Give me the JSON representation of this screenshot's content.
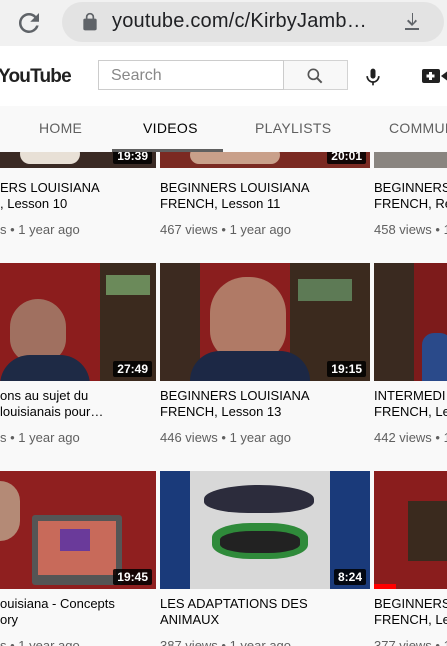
{
  "browser": {
    "url": "youtube.com/c/KirbyJamb…"
  },
  "header": {
    "logo": "YouTube",
    "search_placeholder": "Search"
  },
  "tabs": [
    {
      "label": "HOME",
      "active": false
    },
    {
      "label": "VIDEOS",
      "active": true
    },
    {
      "label": "PLAYLISTS",
      "active": false
    },
    {
      "label": "COMMUN",
      "active": false
    }
  ],
  "videos": [
    {
      "duration": "19:39",
      "title1": "ERS LOUISIANA",
      "title2": ", Lesson 10",
      "meta": "s • 1 year ago"
    },
    {
      "duration": "20:01",
      "title1": "BEGINNERS LOUISIANA",
      "title2": "FRENCH, Lesson 11",
      "meta": "467 views • 1 year ago"
    },
    {
      "duration": "",
      "title1": "BEGINNERS",
      "title2": "FRENCH, Re",
      "meta": "458 views • 1"
    },
    {
      "duration": "27:49",
      "title1": "ons au sujet du",
      "title2": "louisianais pour…",
      "meta": "s • 1 year ago"
    },
    {
      "duration": "19:15",
      "title1": "BEGINNERS LOUISIANA",
      "title2": "FRENCH, Lesson 13",
      "meta": "446 views • 1 year ago"
    },
    {
      "duration": "",
      "title1": "INTERMEDI",
      "title2": "FRENCH, Le",
      "meta": "442 views • 1"
    },
    {
      "duration": "19:45",
      "title1": "ouisiana - Concepts",
      "title2": "ory",
      "meta": "s • 1 year ago"
    },
    {
      "duration": "8:24",
      "title1": "LES ADAPTATIONS DES",
      "title2": "ANIMAUX",
      "meta": "387 views • 1 year ago"
    },
    {
      "duration": "",
      "title1": "BEGINNERS",
      "title2": "FRENCH, Le",
      "meta": "377 views • 1"
    }
  ],
  "colors": {
    "accent": "#ff0000",
    "text_secondary": "#606060",
    "tab_bg": "#f9f9f9"
  }
}
